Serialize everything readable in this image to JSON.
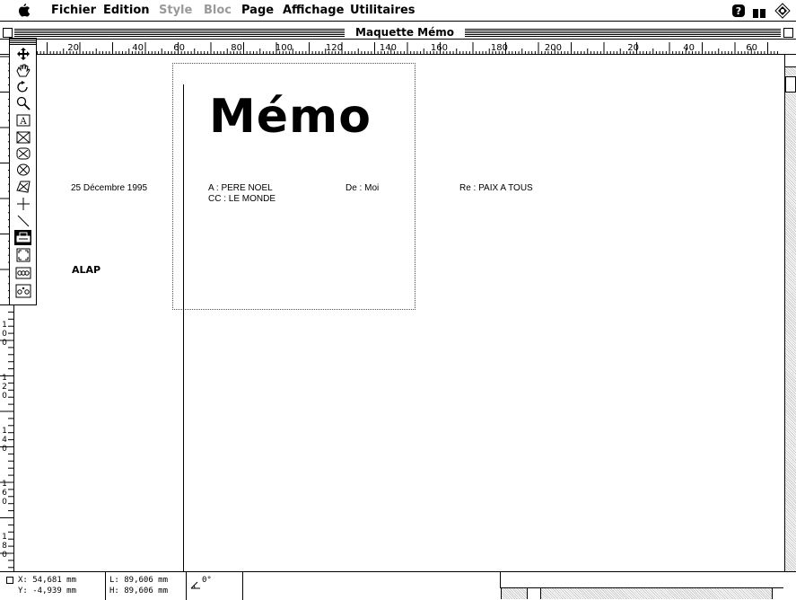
{
  "menubar": {
    "items": [
      {
        "label": "Fichier",
        "enabled": true
      },
      {
        "label": "Edition",
        "enabled": true
      },
      {
        "label": "Style",
        "enabled": false
      },
      {
        "label": "Bloc",
        "enabled": false
      },
      {
        "label": "Page",
        "enabled": true
      },
      {
        "label": "Affichage",
        "enabled": true
      },
      {
        "label": "Utilitaires",
        "enabled": true
      }
    ],
    "icons": [
      "apple-icon",
      "help-icon",
      "window-icon",
      "finder-icon"
    ]
  },
  "window": {
    "title": "Maquette Mémo"
  },
  "hruler": {
    "labels": [
      "20",
      "40",
      "60",
      "80",
      "100",
      "120",
      "140",
      "160",
      "180",
      "200",
      "20",
      "40",
      "60"
    ]
  },
  "vruler": {
    "labels": [
      "100",
      "120",
      "140",
      "160",
      "180"
    ]
  },
  "toolbar": {
    "tools": [
      "move-tool-icon",
      "grab-tool-icon",
      "rotate-tool-icon",
      "zoom-tool-icon",
      "text-box-tool-icon",
      "picture-box-rect-icon",
      "picture-box-oval-icon",
      "picture-box-round-icon",
      "picture-box-polygon-icon",
      "orthogonal-line-tool-icon",
      "line-tool-icon",
      "printer-icon",
      "expand-icon",
      "link-tool-icon",
      "unlink-tool-icon"
    ]
  },
  "document": {
    "title": "Mémo",
    "date": "25 Décembre 1995",
    "to": "A :  PERE NOEL",
    "cc": "CC : LE MONDE",
    "from": "De :  Moi",
    "re": "Re :  PAIX A TOUS",
    "alap": "ALAP"
  },
  "statusbar": {
    "x": "X: 54,681 mm",
    "y": "Y: -4,939 mm",
    "l": "L: 89,606 mm",
    "h": "H: 89,606 mm",
    "angle": "0°"
  }
}
